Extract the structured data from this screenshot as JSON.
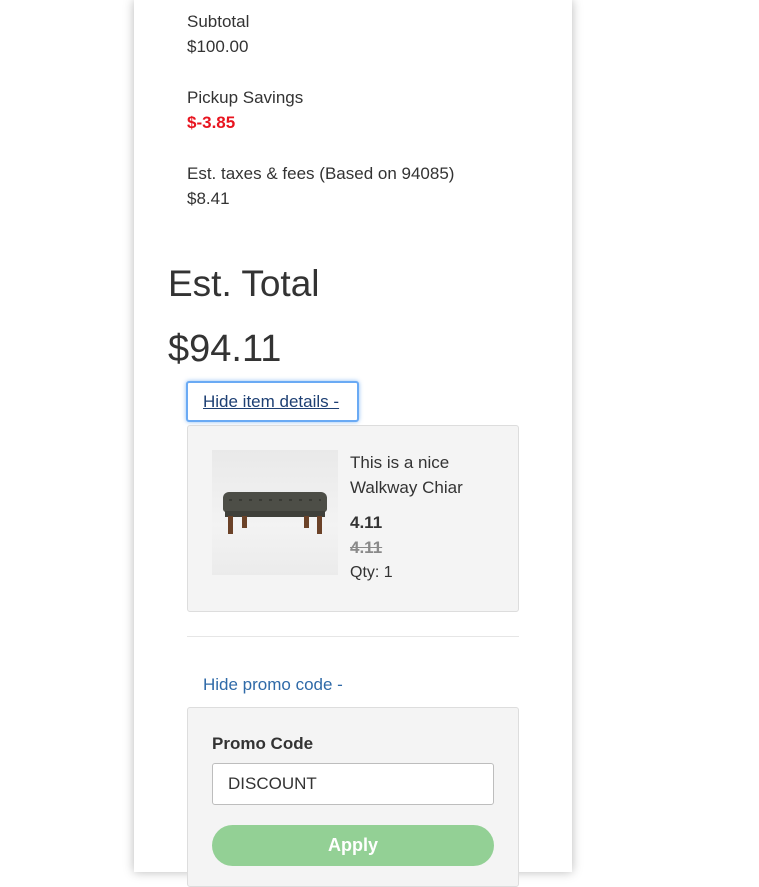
{
  "summary": {
    "subtotal_label": "Subtotal",
    "subtotal_value": "$100.00",
    "savings_label": "Pickup Savings",
    "savings_value": "$-3.85",
    "taxes_label": "Est. taxes & fees (Based on 94085)",
    "taxes_value": "$8.41"
  },
  "total": {
    "label": "Est. Total",
    "value": "$94.11"
  },
  "item_details": {
    "toggle_label": "Hide item details -",
    "item": {
      "image_icon": "bench-product-image",
      "title": "This is a nice Walkway Chiar",
      "price": "4.11",
      "original_price": "4.11",
      "qty": "Qty: 1"
    }
  },
  "promo": {
    "toggle_label": "Hide promo code -",
    "label": "Promo Code",
    "input_value": "DISCOUNT",
    "apply_label": "Apply"
  },
  "colors": {
    "savings": "#e8141f",
    "link": "#2f6aa8",
    "focus_ring": "#6aaaf4",
    "apply_button": "#93d095"
  }
}
